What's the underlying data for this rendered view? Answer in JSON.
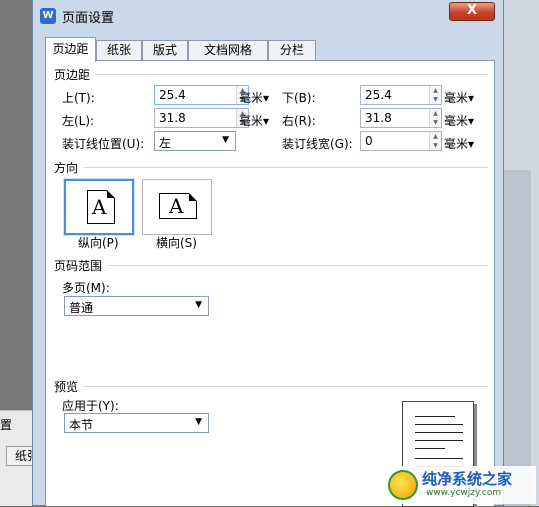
{
  "dialog": {
    "title": "页面设置",
    "close_symbol": "X"
  },
  "tabs": [
    "页边距",
    "纸张",
    "版式",
    "文档网格",
    "分栏"
  ],
  "margins": {
    "group_label": "页边距",
    "top_label": "上(T):",
    "top_value": "25.4",
    "bottom_label": "下(B):",
    "bottom_value": "25.4",
    "left_label": "左(L):",
    "left_value": "31.8",
    "right_label": "右(R):",
    "right_value": "31.8",
    "unit": "毫米▾",
    "gutter_pos_label": "装订线位置(U):",
    "gutter_pos_value": "左",
    "gutter_width_label": "装订线宽(G):",
    "gutter_width_value": "0"
  },
  "orientation": {
    "group_label": "方向",
    "portrait_label": "纵向(P)",
    "landscape_label": "横向(S)",
    "icon_letter": "A"
  },
  "pages": {
    "group_label": "页码范围",
    "multi_label": "多页(M):",
    "multi_value": "普通"
  },
  "preview": {
    "group_label": "预览",
    "apply_label": "应用于(Y):",
    "apply_value": "本节"
  },
  "background": {
    "label": "置",
    "tab": "纸张"
  },
  "watermark": {
    "name": "纯净系统之家",
    "url": "www.ycwjzy.com"
  }
}
